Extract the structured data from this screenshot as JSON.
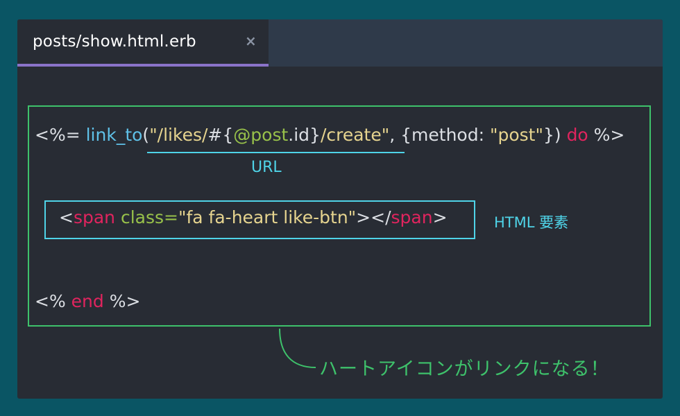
{
  "tab": {
    "label": "posts/show.html.erb",
    "close_glyph": "×"
  },
  "code": {
    "line1": {
      "open": "<%= ",
      "func": "link_to",
      "paren_open": "(",
      "str_a": "\"/likes/",
      "interp_open": "#{",
      "ivar": "@post",
      "method": ".id",
      "interp_close": "}",
      "str_b": "/create\"",
      "rest": ", {method: ",
      "str_post": "\"post\"",
      "rest2": "}) ",
      "kw_do": "do",
      "close": " %>"
    },
    "line2": {
      "lt": "<",
      "tag": "span",
      "space": " ",
      "attr": "class=",
      "value": "\"fa fa-heart like-btn\"",
      "mid": "></",
      "tag_close": "span",
      "gt": ">"
    },
    "line3": {
      "open": "<% ",
      "kw_end": "end",
      "close": " %>"
    }
  },
  "annotations": {
    "url_label": "URL",
    "html_label": "HTML 要素",
    "callout": "ハートアイコンがリンクになる！"
  },
  "colors": {
    "background": "#0a5564",
    "editor": "#282c34",
    "tab_accent": "#8a73c9",
    "frame_green": "#3ec26b",
    "cyan": "#4fd4e8",
    "keyword": "#e0245e",
    "string": "#e6d48f",
    "function": "#5fc1e8",
    "ivar": "#98c14a"
  }
}
